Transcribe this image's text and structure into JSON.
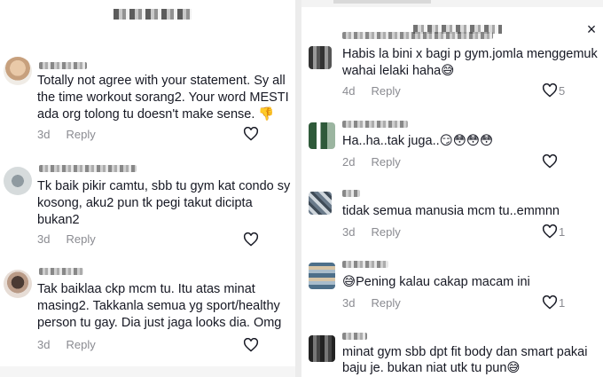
{
  "left": {
    "comments": [
      {
        "lines": [
          "Totally not agree with your statement. Sy all",
          "the time workout sorang2. Your word MESTI",
          "ada org tolong tu doesn't make sense. 👎"
        ],
        "age": "3d",
        "reply": "Reply"
      },
      {
        "lines": [
          "Tk baik pikir camtu, sbb tu gym kat condo sy",
          "kosong, aku2 pun tk pegi takut dicipta",
          "bukan2"
        ],
        "age": "3d",
        "reply": "Reply"
      },
      {
        "lines": [
          "Tak baiklaa ckp mcm tu. Itu atas minat",
          "masing2. Takkanla semua yg sport/healthy",
          "person tu gay. Dia just jaga looks dia. Omg"
        ],
        "age": "3d",
        "reply": "Reply"
      }
    ]
  },
  "right": {
    "close_icon": "×",
    "comments": [
      {
        "lines": [
          "Habis la bini x bagi p gym.jomla menggemuk",
          "wahai lelaki haha😅"
        ],
        "age": "4d",
        "reply": "Reply",
        "likes": "5"
      },
      {
        "lines": [
          "Ha..ha..tak juga..😏😳😳😳"
        ],
        "age": "2d",
        "reply": "Reply",
        "likes": ""
      },
      {
        "lines": [
          "tidak semua manusia mcm tu..emmnn"
        ],
        "age": "3d",
        "reply": "Reply",
        "likes": "1"
      },
      {
        "lines": [
          "😅Pening kalau cakap macam ini"
        ],
        "age": "3d",
        "reply": "Reply",
        "likes": "1"
      },
      {
        "lines": [
          "minat gym sbb dpt fit body dan smart pakai",
          "baju je. bukan niat utk tu pun😅"
        ],
        "age": "",
        "reply": "",
        "likes": ""
      }
    ]
  },
  "icons": {
    "heart": "heart-outline-icon",
    "close": "close-icon"
  },
  "colors": {
    "text": "#161823",
    "meta": "#8a8b91"
  }
}
